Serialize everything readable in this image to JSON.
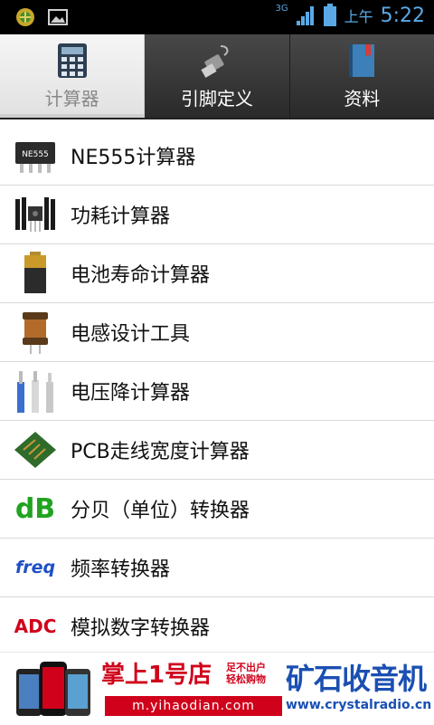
{
  "status_bar": {
    "network": "3G",
    "clock_ampm": "上午",
    "clock_time": "5:22"
  },
  "tabs": [
    {
      "label": "计算器",
      "icon": "calculator-icon",
      "active": true
    },
    {
      "label": "引脚定义",
      "icon": "usb-plug-icon",
      "active": false
    },
    {
      "label": "资料",
      "icon": "book-icon",
      "active": false
    }
  ],
  "list": [
    {
      "label": "NE555计算器",
      "icon": "ic-chip-icon",
      "chip_text": "NE555"
    },
    {
      "label": "功耗计算器",
      "icon": "heatsink-icon"
    },
    {
      "label": "电池寿命计算器",
      "icon": "battery-icon"
    },
    {
      "label": "电感设计工具",
      "icon": "inductor-icon"
    },
    {
      "label": "电压降计算器",
      "icon": "wire-icon"
    },
    {
      "label": "PCB走线宽度计算器",
      "icon": "pcb-icon"
    },
    {
      "label": "分贝（单位）转换器",
      "icon": "db-icon",
      "icon_text": "dB"
    },
    {
      "label": "频率转换器",
      "icon": "freq-icon",
      "icon_text": "freq"
    },
    {
      "label": "模拟数字转换器",
      "icon": "adc-icon",
      "icon_text": "ADC"
    }
  ],
  "ad": {
    "brand_title": "掌上1号店",
    "brand_sub_1": "足不出户",
    "brand_sub_2": "轻松购物",
    "brand_url": "m.yihaodian.com",
    "crystal_title": "矿石收音机",
    "crystal_url": "www.crystalradio.cn"
  }
}
